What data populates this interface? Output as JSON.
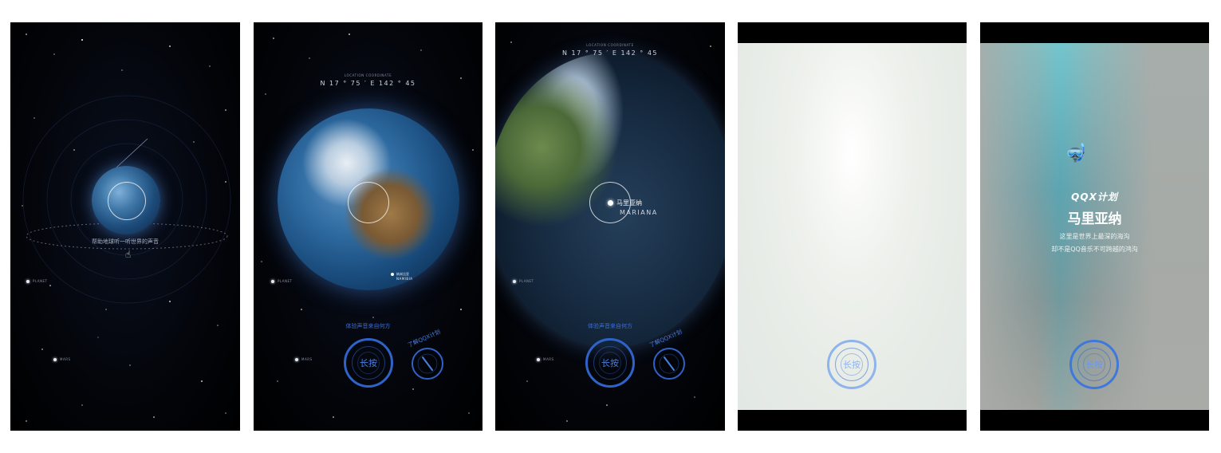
{
  "panel1": {
    "caption": "帮助地球听一听世界的声音",
    "planets": [
      "PLANET",
      "MARS"
    ]
  },
  "panel2": {
    "coords_title": "LOCATION COORDINATE",
    "coords_value": "N 17 ° 75 ′ E 142 ° 45",
    "country_cn": "纳米比亚",
    "country_en": "NAMIBIA",
    "caption": "体验声音来自何方",
    "longpress": "长按",
    "learn_more": "了解QQX计划",
    "planets": [
      "PLANET",
      "MARS"
    ]
  },
  "panel3": {
    "coords_title": "LOCATION COORDINATE",
    "coords_value": "N 17 ° 75 ′ E 142 ° 45",
    "place_cn": "马里亚纳",
    "place_en": "MARIANA",
    "caption": "体验声音来自何方",
    "longpress": "长按",
    "learn_more": "了解QQX计划",
    "planets": [
      "PLANET",
      "MARS"
    ]
  },
  "panel4": {
    "longpress": "长按"
  },
  "panel5": {
    "logo": "QQX计划",
    "title": "马里亚纳",
    "desc_line1": "这里是世界上最深的海沟",
    "desc_line2": "却不是QQ音乐不可跨越的鸿沟",
    "longpress": "长按"
  },
  "colors": {
    "accent_blue": "#2f63c8",
    "space": "#000000"
  }
}
